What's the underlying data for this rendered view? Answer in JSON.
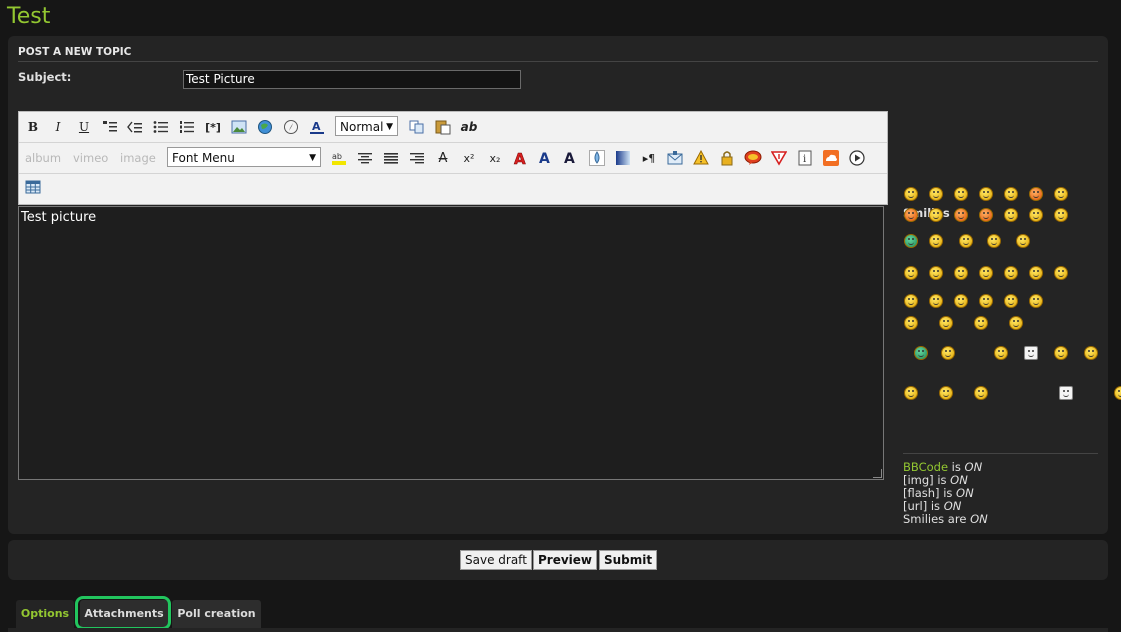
{
  "page": {
    "title": "Test"
  },
  "form": {
    "heading": "POST A NEW TOPIC",
    "subject_label": "Subject:",
    "subject_value": "Test Picture",
    "message_text": "Test picture"
  },
  "toolbar": {
    "row1": {
      "bold": "B",
      "italic": "I",
      "underline": "U",
      "code": "[*]",
      "font_size_value": "Normal",
      "spell": "ab",
      "icons": [
        "bold-icon",
        "italic-icon",
        "underline-icon",
        "quote-icon",
        "code-icon",
        "bullet-list-icon",
        "numbered-list-icon",
        "list-item-icon",
        "image-icon",
        "globe-link-icon",
        "compass-icon",
        "font-color-icon",
        "copy-icon",
        "paste-icon",
        "spellcheck-icon"
      ]
    },
    "row2": {
      "album": "album",
      "vimeo": "vimeo",
      "image": "image",
      "font_menu_value": "Font Menu",
      "strike": "A",
      "superscript": "x²",
      "subscript": "x₂",
      "icons": [
        "highlight-icon",
        "align-center-icon",
        "justify-icon",
        "align-right-icon",
        "strikethrough-icon",
        "superscript-icon",
        "subscript-icon",
        "font-red-icon",
        "font-blue-icon",
        "font-dark-icon",
        "drop-icon",
        "gradient-icon",
        "paragraph-icon",
        "mail-icon",
        "warning-icon",
        "lock-icon",
        "speech-icon",
        "down-triangle-icon",
        "info-icon",
        "soundcloud-icon",
        "play-icon"
      ]
    },
    "row3": {
      "icons": [
        "table-icon"
      ]
    }
  },
  "smilies": {
    "title": "Smilies",
    "rows": [
      [
        "laugh",
        "smile",
        "cool",
        "grin",
        "sad",
        "angry",
        "wink"
      ],
      [
        "mad",
        "tongue",
        "evil",
        "devil",
        "shock",
        "blush",
        "happy"
      ],
      [
        "monster",
        "lamp",
        "small-smile",
        "glasses-pair",
        "ghost"
      ],
      [
        "hat",
        "rocker",
        "laughing",
        "thinking",
        "coffee",
        "worried",
        "confused"
      ],
      [
        "guitar",
        "drink",
        "clapping",
        "smiley-plain",
        "ask",
        "hmm"
      ],
      [
        "sleep",
        "waving",
        "point",
        "plane"
      ],
      [
        "alien",
        "bunny",
        "popcorn",
        "bucket",
        "umbrella",
        "moon"
      ],
      [
        "plain-face",
        "lick",
        "faint",
        "toilet",
        "plain-face-2"
      ]
    ],
    "colors": {
      "yellow": "#f5c518",
      "orange": "#e87a1f",
      "green": "#2e9c5c"
    }
  },
  "status": {
    "bbcode_label": "BBCode",
    "bbcode_mid": " is ",
    "bbcode_value": "ON",
    "img_label": "[img]",
    "img_mid": " is ",
    "img_value": "ON",
    "flash_label": "[flash]",
    "flash_mid": " is ",
    "flash_value": "ON",
    "url_label": "[url]",
    "url_mid": " is ",
    "url_value": "ON",
    "smilies_label": "Smilies",
    "smilies_mid": " are ",
    "smilies_value": "ON"
  },
  "buttons": {
    "save_draft": "Save draft",
    "preview": "Preview",
    "submit": "Submit"
  },
  "tabs": [
    {
      "label": "Options"
    },
    {
      "label": "Attachments"
    },
    {
      "label": "Poll creation"
    }
  ],
  "theme": {
    "accent": "#93c731",
    "highlight_outline": "#22c55e",
    "panel_bg": "#242424",
    "page_bg": "#161616"
  }
}
